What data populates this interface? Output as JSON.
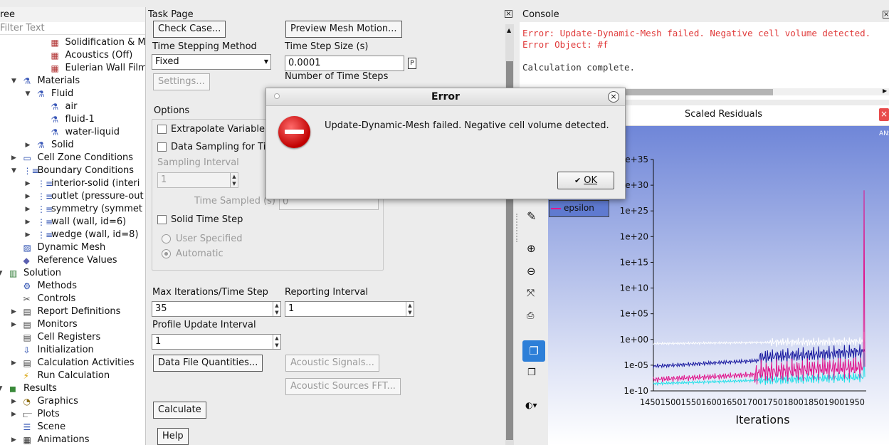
{
  "tree": {
    "header": "ree",
    "filter_placeholder": "Filter Text",
    "items": [
      {
        "label": "Solidification & Mel",
        "depth": 3,
        "arrow": "",
        "icon": "model-icon"
      },
      {
        "label": "Acoustics (Off)",
        "depth": 3,
        "arrow": "",
        "icon": "model-icon"
      },
      {
        "label": "Eulerian Wall Film (",
        "depth": 3,
        "arrow": "",
        "icon": "model-icon"
      },
      {
        "label": "Materials",
        "depth": 1,
        "arrow": "expanded",
        "icon": "flask-icon"
      },
      {
        "label": "Fluid",
        "depth": 2,
        "arrow": "expanded",
        "icon": "flask-icon"
      },
      {
        "label": "air",
        "depth": 3,
        "arrow": "",
        "icon": "flask-icon"
      },
      {
        "label": "fluid-1",
        "depth": 3,
        "arrow": "",
        "icon": "flask-icon"
      },
      {
        "label": "water-liquid",
        "depth": 3,
        "arrow": "",
        "icon": "flask-icon"
      },
      {
        "label": "Solid",
        "depth": 2,
        "arrow": "collapsed",
        "icon": "flask-icon"
      },
      {
        "label": "Cell Zone Conditions",
        "depth": 1,
        "arrow": "collapsed",
        "icon": "cell-zone-icon"
      },
      {
        "label": "Boundary Conditions",
        "depth": 1,
        "arrow": "expanded",
        "icon": "boundary-icon"
      },
      {
        "label": "interior-solid (interi",
        "depth": 2,
        "arrow": "collapsed",
        "icon": "boundary-icon"
      },
      {
        "label": "outlet (pressure-out",
        "depth": 2,
        "arrow": "collapsed",
        "icon": "boundary-icon"
      },
      {
        "label": "symmetry (symmet",
        "depth": 2,
        "arrow": "collapsed",
        "icon": "boundary-icon"
      },
      {
        "label": "wall (wall, id=6)",
        "depth": 2,
        "arrow": "collapsed",
        "icon": "boundary-icon"
      },
      {
        "label": "wedge (wall, id=8)",
        "depth": 2,
        "arrow": "collapsed",
        "icon": "boundary-icon"
      },
      {
        "label": "Dynamic Mesh",
        "depth": 1,
        "arrow": "",
        "icon": "dynamic-mesh-icon"
      },
      {
        "label": "Reference Values",
        "depth": 1,
        "arrow": "",
        "icon": "reference-values-icon"
      },
      {
        "label": "Solution",
        "depth": 0,
        "arrow": "expanded",
        "icon": "solution-icon"
      },
      {
        "label": "Methods",
        "depth": 1,
        "arrow": "",
        "icon": "methods-icon"
      },
      {
        "label": "Controls",
        "depth": 1,
        "arrow": "",
        "icon": "controls-icon"
      },
      {
        "label": "Report Definitions",
        "depth": 1,
        "arrow": "collapsed",
        "icon": "report-icon"
      },
      {
        "label": "Monitors",
        "depth": 1,
        "arrow": "collapsed",
        "icon": "monitors-icon"
      },
      {
        "label": "Cell Registers",
        "depth": 1,
        "arrow": "",
        "icon": "cell-registers-icon"
      },
      {
        "label": "Initialization",
        "depth": 1,
        "arrow": "",
        "icon": "initialization-icon"
      },
      {
        "label": "Calculation Activities",
        "depth": 1,
        "arrow": "collapsed",
        "icon": "calc-activities-icon"
      },
      {
        "label": "Run Calculation",
        "depth": 1,
        "arrow": "",
        "icon": "run-calculation-icon"
      },
      {
        "label": "Results",
        "depth": 0,
        "arrow": "expanded",
        "icon": "results-icon"
      },
      {
        "label": "Graphics",
        "depth": 1,
        "arrow": "collapsed",
        "icon": "graphics-icon"
      },
      {
        "label": "Plots",
        "depth": 1,
        "arrow": "collapsed",
        "icon": "plots-icon"
      },
      {
        "label": "Scene",
        "depth": 1,
        "arrow": "",
        "icon": "scene-icon"
      },
      {
        "label": "Animations",
        "depth": 1,
        "arrow": "collapsed",
        "icon": "animations-icon"
      }
    ]
  },
  "task": {
    "header": "Task Page",
    "check_case": "Check Case...",
    "preview_mesh_motion": "Preview Mesh Motion...",
    "time_stepping_method_label": "Time Stepping Method",
    "time_stepping_method_value": "Fixed",
    "time_step_size_label": "Time Step Size (s)",
    "time_step_size_value": "0.0001",
    "param_badge": "P",
    "num_time_steps_label": "Number of Time Steps",
    "settings": "Settings...",
    "options_label": "Options",
    "extrapolate": "Extrapolate Variable",
    "data_sampling": "Data Sampling for Ti",
    "sampling_interval_label": "Sampling Interval",
    "sampling_interval_value": "1",
    "time_sampled_label": "Time Sampled (s)",
    "time_sampled_value": "0",
    "solid_time_step": "Solid Time Step",
    "user_specified": "User Specified",
    "automatic": "Automatic",
    "max_iter_label": "Max Iterations/Time Step",
    "max_iter_value": "35",
    "reporting_interval_label": "Reporting Interval",
    "reporting_interval_value": "1",
    "profile_update_label": "Profile Update Interval",
    "profile_update_value": "1",
    "data_file_quantities": "Data File Quantities...",
    "acoustic_signals": "Acoustic Signals...",
    "acoustic_sources_fft": "Acoustic Sources FFT...",
    "calculate": "Calculate",
    "help": "Help"
  },
  "console": {
    "header": "Console",
    "lines": [
      {
        "text": "Error: Update-Dynamic-Mesh failed. Negative cell volume detected.",
        "color": "#e03a3a"
      },
      {
        "text": "Error Object: #f",
        "color": "#e03a3a"
      },
      {
        "text": "",
        "color": "#333333"
      },
      {
        "text": "Calculation complete.",
        "color": "#333333"
      }
    ]
  },
  "residuals": {
    "window_title": "Scaled Residuals",
    "logo_text": "ANS",
    "legend_visible_entry": "epsilon",
    "legend_color": "#e0148c"
  },
  "chart_data": {
    "type": "line",
    "title": "",
    "xlabel": "Iterations",
    "ylabel": "",
    "x_ticks": [
      "1450",
      "1500",
      "1550",
      "1600",
      "1650",
      "1700",
      "1750",
      "1800",
      "1850",
      "1900",
      "1950"
    ],
    "x_tick_labels_rendered": "14501500155016001650170017501800185019001950",
    "ylim_log10": [
      -10,
      35
    ],
    "y_ticks": [
      "1e-10",
      "1e-05",
      "1e+00",
      "1e+05",
      "1e+10",
      "1e+15",
      "1e+20",
      "1e+25",
      "1e+30",
      "1e+35"
    ],
    "series": [
      {
        "name": "epsilon",
        "color": "#e0148c"
      }
    ],
    "series_colors_unlabeled": [
      "#ffffff",
      "#1a1aa0",
      "#20e0e8",
      "#e0148c"
    ]
  },
  "dialog": {
    "title": "Error",
    "message": "Update-Dynamic-Mesh failed. Negative cell volume detected.",
    "ok": "OK"
  }
}
